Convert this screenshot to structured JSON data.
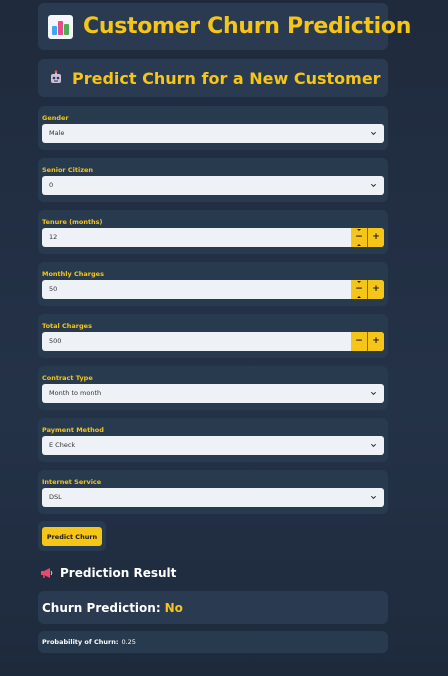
{
  "header": {
    "title": "Customer Churn Prediction",
    "icon": "bar-chart-icon",
    "subtitle": "Predict Churn for a New Customer",
    "subtitle_icon": "robot-icon"
  },
  "form": {
    "gender": {
      "label": "Gender",
      "value": "Male"
    },
    "senior_citizen": {
      "label": "Senior Citizen",
      "value": "0"
    },
    "tenure": {
      "label": "Tenure (months)",
      "value": "12"
    },
    "monthly_charges": {
      "label": "Monthly Charges",
      "value": "50"
    },
    "total_charges": {
      "label": "Total Charges",
      "value": "500"
    },
    "contract_type": {
      "label": "Contract Type",
      "value": "Month to month"
    },
    "payment_method": {
      "label": "Payment Method",
      "value": "E Check"
    },
    "internet_service": {
      "label": "Internet Service",
      "value": "DSL"
    },
    "stepper_minus": "−",
    "stepper_plus": "+"
  },
  "actions": {
    "predict_label": "Predict Churn"
  },
  "result": {
    "title": "Prediction Result",
    "icon": "megaphone-icon",
    "churn_label": "Churn Prediction:",
    "churn_value": "No",
    "probability_label": "Probability of Churn:",
    "probability_value": "0.25"
  },
  "colors": {
    "accent": "#f5c518",
    "background": "#1f2a3c",
    "card": "#2a3a50",
    "input": "#eef2f7"
  }
}
